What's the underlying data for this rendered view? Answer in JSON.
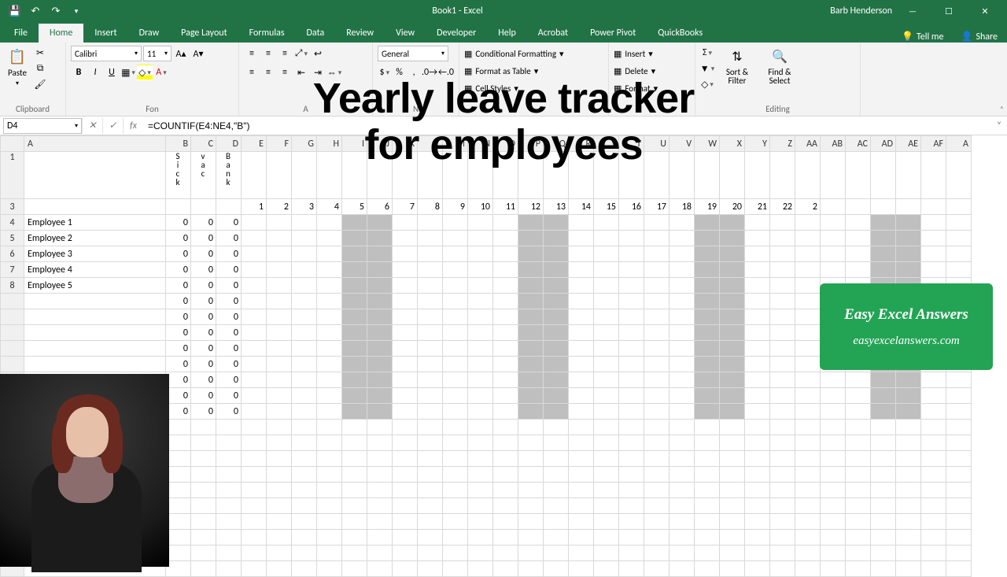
{
  "titlebar": {
    "title": "Book1 - Excel",
    "username": "Barb Henderson"
  },
  "ribbon": {
    "tabs": [
      "File",
      "Home",
      "Insert",
      "Draw",
      "Page Layout",
      "Formulas",
      "Data",
      "Review",
      "View",
      "Developer",
      "Help",
      "Acrobat",
      "Power Pivot",
      "QuickBooks"
    ],
    "active": "Home",
    "tellme": "Tell me",
    "share": "Share",
    "groups": {
      "clipboard": {
        "label": "Clipboard",
        "paste": "Paste"
      },
      "font": {
        "label": "Fon",
        "name": "Calibri",
        "size": "11"
      },
      "alignment": {
        "label": "A"
      },
      "number": {
        "label": "N",
        "format": "General"
      },
      "styles": {
        "label": "",
        "cond": "Conditional Formatting",
        "table": "Format as Table",
        "cell": "Cell Styles"
      },
      "cells": {
        "label": "",
        "insert": "Insert",
        "delete": "Delete",
        "format": "Format"
      },
      "editing": {
        "label": "Editing",
        "sort": "Sort & Filter",
        "find": "Find & Select"
      }
    }
  },
  "formula": {
    "nameBox": "D4",
    "formula": "=COUNTIF(E4:NE4,\"B\")"
  },
  "overlay": {
    "line1": "Yearly leave tracker",
    "line2": "for employees"
  },
  "badge": {
    "line1": "Easy Excel Answers",
    "line2": "easyexcelanswers.com"
  },
  "sheet": {
    "columns": [
      "A",
      "B",
      "C",
      "D",
      "E",
      "F",
      "G",
      "H",
      "I",
      "J",
      "K",
      "L",
      "M",
      "N",
      "O",
      "P",
      "Q",
      "R",
      "S",
      "T",
      "U",
      "V",
      "W",
      "X",
      "Y",
      "Z",
      "AA",
      "AB",
      "AC",
      "AD",
      "AE",
      "AF",
      "A"
    ],
    "row1": {
      "B": "Sick",
      "C": "vac",
      "D": "Bank"
    },
    "row3_days": [
      "1",
      "2",
      "3",
      "4",
      "5",
      "6",
      "7",
      "8",
      "9",
      "10",
      "11",
      "12",
      "13",
      "14",
      "15",
      "16",
      "17",
      "18",
      "19",
      "20",
      "21",
      "22",
      "2"
    ],
    "employees": [
      {
        "row": "4",
        "name": "Employee 1",
        "sick": "0",
        "vac": "0",
        "bank": "0"
      },
      {
        "row": "5",
        "name": "Employee 2",
        "sick": "0",
        "vac": "0",
        "bank": "0"
      },
      {
        "row": "6",
        "name": "Employee 3",
        "sick": "0",
        "vac": "0",
        "bank": "0"
      },
      {
        "row": "7",
        "name": "Employee 4",
        "sick": "0",
        "vac": "0",
        "bank": "0"
      },
      {
        "row": "8",
        "name": "Employee 5",
        "sick": "0",
        "vac": "0",
        "bank": "0"
      }
    ],
    "extraRows": [
      "",
      "",
      "",
      "",
      "",
      "",
      "",
      ""
    ],
    "shadedCols": [
      "I",
      "J",
      "P",
      "Q",
      "W",
      "X",
      "AD",
      "AE"
    ]
  }
}
